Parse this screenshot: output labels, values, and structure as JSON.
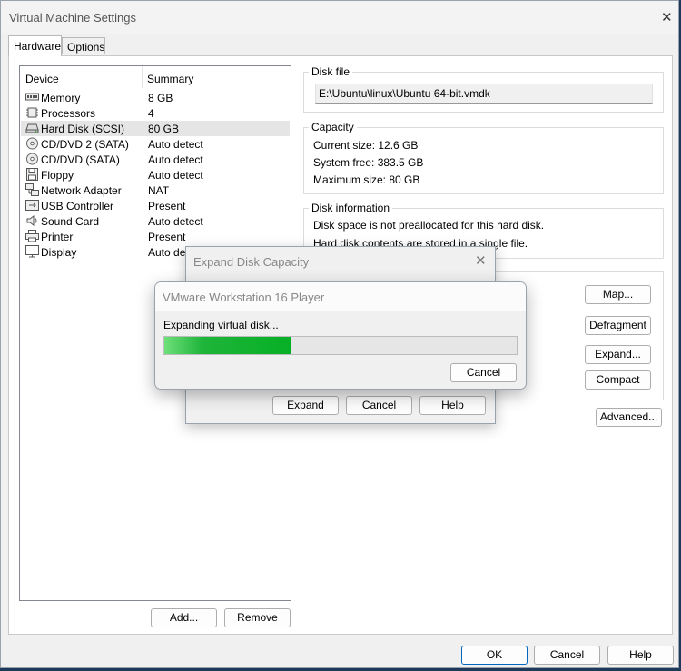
{
  "window": {
    "title": "Virtual Machine Settings",
    "tabs": [
      {
        "label": "Hardware",
        "active": true
      },
      {
        "label": "Options",
        "active": false
      }
    ]
  },
  "devices": {
    "header": {
      "device": "Device",
      "summary": "Summary"
    },
    "items": [
      {
        "icon": "memory-icon",
        "name": "Memory",
        "summary": "8 GB"
      },
      {
        "icon": "processor-icon",
        "name": "Processors",
        "summary": "4"
      },
      {
        "icon": "hard-disk-icon",
        "name": "Hard Disk (SCSI)",
        "summary": "80 GB",
        "selected": true
      },
      {
        "icon": "cd-dvd-icon",
        "name": "CD/DVD 2 (SATA)",
        "summary": "Auto detect"
      },
      {
        "icon": "cd-dvd-icon",
        "name": "CD/DVD (SATA)",
        "summary": "Auto detect"
      },
      {
        "icon": "floppy-icon",
        "name": "Floppy",
        "summary": "Auto detect"
      },
      {
        "icon": "network-adapter-icon",
        "name": "Network Adapter",
        "summary": "NAT"
      },
      {
        "icon": "usb-icon",
        "name": "USB Controller",
        "summary": "Present"
      },
      {
        "icon": "sound-card-icon",
        "name": "Sound Card",
        "summary": "Auto detect"
      },
      {
        "icon": "printer-icon",
        "name": "Printer",
        "summary": "Present"
      },
      {
        "icon": "display-icon",
        "name": "Display",
        "summary": "Auto detect"
      }
    ],
    "add_label": "Add...",
    "remove_label": "Remove"
  },
  "disk_file": {
    "label": "Disk file",
    "path": "E:\\Ubuntu\\linux\\Ubuntu 64-bit.vmdk"
  },
  "capacity": {
    "label": "Capacity",
    "current": "Current size:  12.6 GB",
    "free": "System free:  383.5 GB",
    "max": "Maximum size:  80 GB"
  },
  "disk_info": {
    "label": "Disk information",
    "line1": "Disk space is not preallocated for this hard disk.",
    "line2": "Hard disk contents are stored in a single file."
  },
  "utilities": {
    "map": "Map...",
    "defragment": "Defragment",
    "expand": "Expand...",
    "compact": "Compact"
  },
  "advanced_label": "Advanced...",
  "footer": {
    "ok": "OK",
    "cancel": "Cancel",
    "help": "Help"
  },
  "expand_dialog": {
    "title": "Expand Disk Capacity",
    "expand": "Expand",
    "cancel": "Cancel",
    "help": "Help"
  },
  "progress_dialog": {
    "title": "VMware Workstation 16 Player",
    "message": "Expanding virtual disk...",
    "progress_fraction": 0.36,
    "cancel": "Cancel",
    "accent": "#06b025"
  }
}
